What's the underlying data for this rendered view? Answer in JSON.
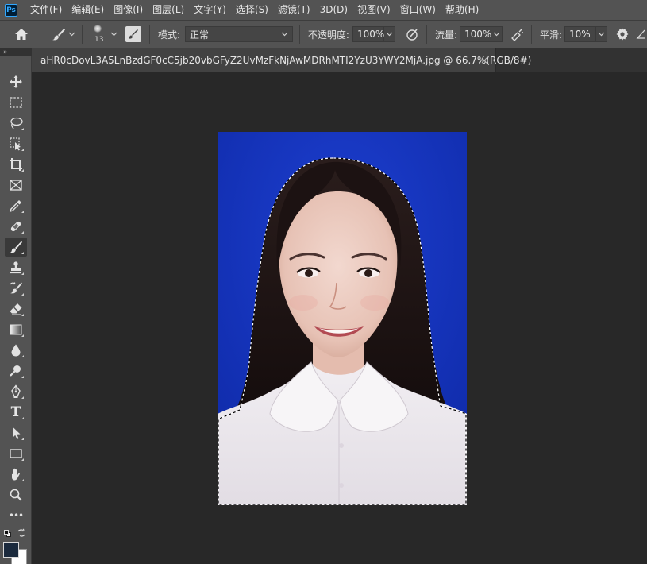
{
  "app": {
    "logo_text": "Ps"
  },
  "menu": [
    "文件(F)",
    "编辑(E)",
    "图像(I)",
    "图层(L)",
    "文字(Y)",
    "选择(S)",
    "滤镜(T)",
    "3D(D)",
    "视图(V)",
    "窗口(W)",
    "帮助(H)"
  ],
  "options": {
    "brush_size": "13",
    "mode_label": "模式:",
    "mode_value": "正常",
    "opacity_label": "不透明度:",
    "opacity_value": "100%",
    "flow_label": "流量:",
    "flow_value": "100%",
    "smoothing_label": "平滑:",
    "smoothing_value": "10%"
  },
  "panel_collapse": "»",
  "document": {
    "tab_title": "aHR0cDovL3A5LnBzdGF0cC5jb20vbGFyZ2UvMzFkNjAwMDRhMTI2YzU3YWY2MjA.jpg @ 66.7%(RGB/8#)",
    "close_glyph": "×"
  },
  "toolbar": {
    "tools": [
      {
        "name": "move-tool",
        "icon": "move-icon"
      },
      {
        "name": "marquee-tool",
        "icon": "marquee-icon"
      },
      {
        "name": "lasso-tool",
        "icon": "lasso-icon"
      },
      {
        "name": "object-select-tool",
        "icon": "object-select-icon"
      },
      {
        "name": "crop-tool",
        "icon": "crop-icon"
      },
      {
        "name": "frame-tool",
        "icon": "frame-icon"
      },
      {
        "name": "eyedropper-tool",
        "icon": "eyedropper-icon"
      },
      {
        "name": "healing-brush-tool",
        "icon": "bandage-icon"
      },
      {
        "name": "brush-tool",
        "icon": "brush-icon"
      },
      {
        "name": "clone-stamp-tool",
        "icon": "stamp-icon"
      },
      {
        "name": "history-brush-tool",
        "icon": "history-brush-icon"
      },
      {
        "name": "eraser-tool",
        "icon": "eraser-icon"
      },
      {
        "name": "gradient-tool",
        "icon": "gradient-icon"
      },
      {
        "name": "blur-tool",
        "icon": "drop-icon"
      },
      {
        "name": "dodge-tool",
        "icon": "dodge-icon"
      },
      {
        "name": "pen-tool",
        "icon": "pen-icon"
      },
      {
        "name": "type-tool",
        "icon": "type-icon"
      },
      {
        "name": "path-select-tool",
        "icon": "arrow-icon"
      },
      {
        "name": "rectangle-tool",
        "icon": "rectangle-icon"
      },
      {
        "name": "hand-tool",
        "icon": "hand-icon"
      },
      {
        "name": "zoom-tool",
        "icon": "zoom-icon"
      },
      {
        "name": "more-tools",
        "icon": "ellipsis-icon"
      }
    ],
    "type_glyph": "T",
    "more_glyph": "•••",
    "active_tool": "brush-tool",
    "foreground_color": "#1b2a3d",
    "background_color": "#ffffff"
  },
  "colors": {
    "photo_background": "#1230b8",
    "selection": "marching-ants"
  }
}
